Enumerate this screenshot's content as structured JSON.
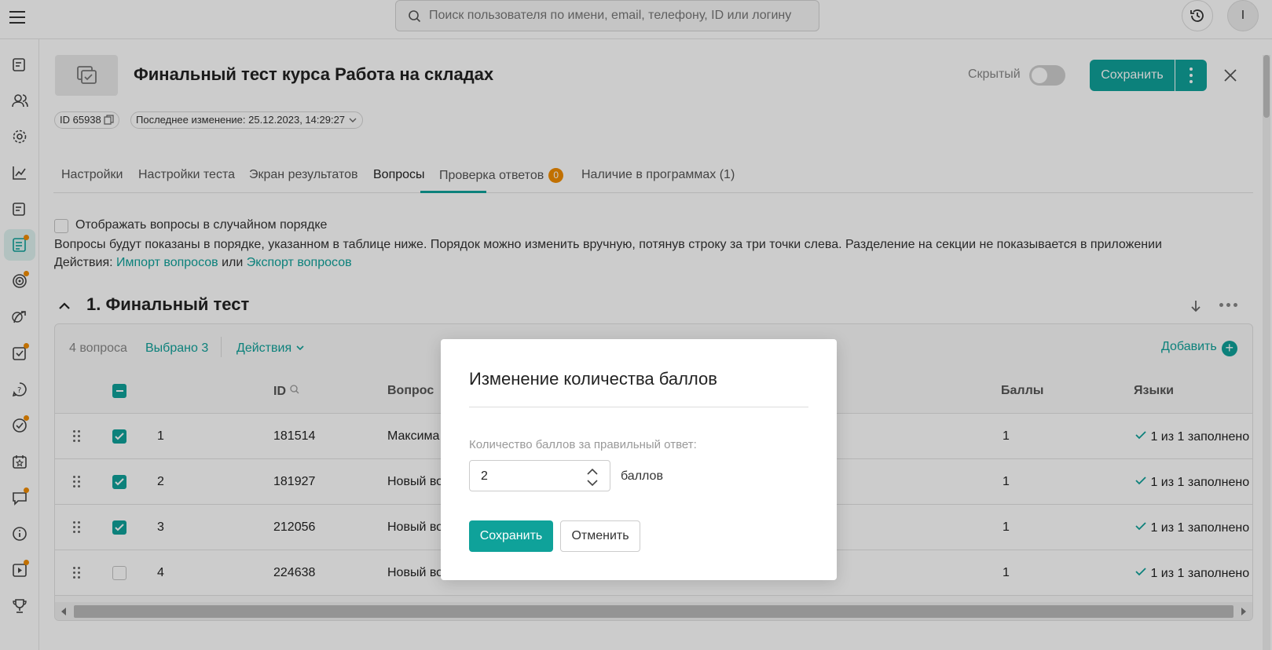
{
  "topbar": {
    "search_placeholder": "Поиск пользователя по имени, email, телефону, ID или логину",
    "avatar_initial": "I"
  },
  "sidebar": {
    "items": [
      {
        "icon": "document-edit-icon",
        "dot": false
      },
      {
        "icon": "users-icon",
        "dot": false
      },
      {
        "icon": "gear-icon",
        "dot": false
      },
      {
        "icon": "chart-icon",
        "dot": false
      },
      {
        "icon": "document-edit-icon",
        "dot": false
      },
      {
        "icon": "test-list-icon",
        "dot": true,
        "active": true
      },
      {
        "icon": "target-icon",
        "dot": true
      },
      {
        "icon": "path-icon",
        "dot": false
      },
      {
        "icon": "check-task-icon",
        "dot": true
      },
      {
        "icon": "question-icon",
        "dot": false
      },
      {
        "icon": "check-circle-icon",
        "dot": true
      },
      {
        "icon": "calendar-star-icon",
        "dot": false
      },
      {
        "icon": "chat-icon",
        "dot": true
      },
      {
        "icon": "info-icon",
        "dot": false
      },
      {
        "icon": "video-icon",
        "dot": true
      },
      {
        "icon": "trophy-icon",
        "dot": false
      }
    ]
  },
  "header": {
    "title": "Финальный тест курса Работа на складах",
    "hidden_label": "Скрытый",
    "save_label": "Сохранить",
    "id_chip": "ID 65938",
    "last_change": "Последнее изменение: 25.12.2023, 14:29:27"
  },
  "tabs": [
    {
      "label": "Настройки"
    },
    {
      "label": "Настройки теста"
    },
    {
      "label": "Экран результатов"
    },
    {
      "label": "Вопросы",
      "active": true
    },
    {
      "label": "Проверка ответов",
      "badge": "0"
    },
    {
      "label": "Наличие в программах (1)"
    }
  ],
  "questions": {
    "random_label": "Отображать вопросы в случайном порядке",
    "info": "Вопросы будут показаны в порядке, указанном в таблице ниже. Порядок можно изменить вручную, потянув строку за три точки слева. Разделение на секции не показывается в приложении",
    "actions_prefix": "Действия:",
    "import_link": "Импорт вопросов",
    "or_text": "или",
    "export_link": "Экспорт вопросов"
  },
  "section": {
    "title": "1. Финальный тест",
    "count_text": "4 вопроса",
    "selected_text": "Выбрано 3",
    "actions_label": "Действия",
    "add_label": "Добавить"
  },
  "table": {
    "columns": {
      "id": "ID",
      "question": "Вопрос",
      "points": "Баллы",
      "languages": "Языки"
    },
    "rows": [
      {
        "num": "1",
        "id": "181514",
        "question": "Максима",
        "points": "1",
        "languages": "1 из 1 заполнено",
        "checked": true
      },
      {
        "num": "2",
        "id": "181927",
        "question": "Новый во",
        "points": "1",
        "languages": "1 из 1 заполнено",
        "checked": true
      },
      {
        "num": "3",
        "id": "212056",
        "question": "Новый во",
        "points": "1",
        "languages": "1 из 1 заполнено",
        "checked": true
      },
      {
        "num": "4",
        "id": "224638",
        "question": "Новый вопро",
        "points": "1",
        "languages": "1 из 1 заполнено",
        "checked": false
      }
    ]
  },
  "modal": {
    "title": "Изменение количества баллов",
    "label": "Количество баллов за правильный ответ:",
    "value": "2",
    "unit": "баллов",
    "save_label": "Сохранить",
    "cancel_label": "Отменить"
  },
  "colors": {
    "accent": "#0fa29a",
    "badge": "#f28c00",
    "overlay": "rgba(0,0,0,0.2)"
  }
}
